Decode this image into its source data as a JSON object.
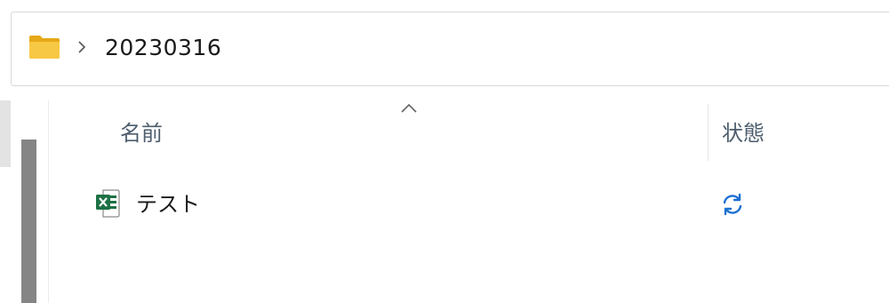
{
  "address_bar": {
    "breadcrumb_folder": "20230316"
  },
  "columns": {
    "name_header": "名前",
    "status_header": "状態",
    "sort_direction": "ascending"
  },
  "files": [
    {
      "name": "テスト",
      "type_icon": "excel-file-icon",
      "status_icon": "sync-pending-icon"
    }
  ],
  "colors": {
    "folder_yellow": "#f7c843",
    "excel_green": "#1e7145",
    "sync_blue": "#1a6fd1",
    "header_text": "#4d5d6d"
  }
}
